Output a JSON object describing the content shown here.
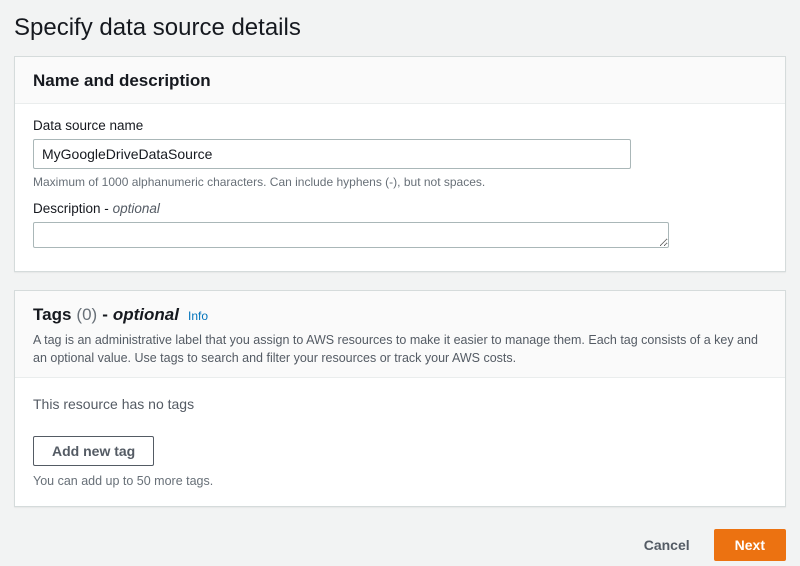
{
  "page": {
    "title": "Specify data source details"
  },
  "nameSection": {
    "header": "Name and description",
    "nameLabel": "Data source name",
    "nameValue": "MyGoogleDriveDataSource",
    "nameHint": "Maximum of 1000 alphanumeric characters. Can include hyphens (-), but not spaces.",
    "descLabel": "Description",
    "descDash": "-",
    "descOptional": "optional",
    "descValue": ""
  },
  "tagsSection": {
    "title": "Tags",
    "count": "(0)",
    "dash": "-",
    "optional": "optional",
    "info": "Info",
    "desc": "A tag is an administrative label that you assign to AWS resources to make it easier to manage them. Each tag consists of a key and an optional value. Use tags to search and filter your resources or track your AWS costs.",
    "emptyMsg": "This resource has no tags",
    "addBtn": "Add new tag",
    "hint": "You can add up to 50 more tags."
  },
  "footer": {
    "cancel": "Cancel",
    "next": "Next"
  }
}
